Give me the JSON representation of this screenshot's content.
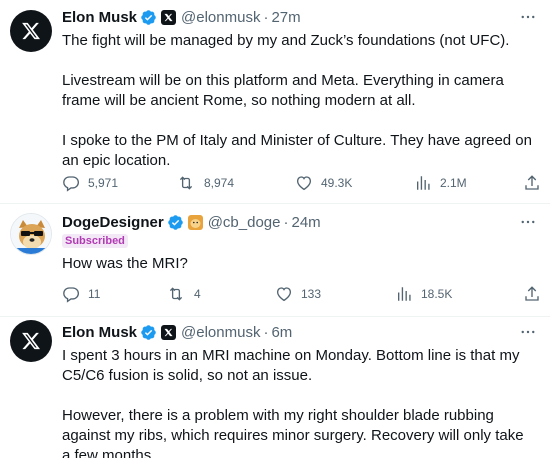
{
  "tweets": [
    {
      "name": "Elon Musk",
      "handle": "@elonmusk",
      "separator": "·",
      "time": "27m",
      "paragraphs": [
        "The fight will be managed by my and Zuck’s foundations (not UFC).",
        "Livestream will be on this platform and Meta. Everything in camera frame will be ancient Rome, so nothing modern at all.",
        "I spoke to the PM of Italy and Minister of Culture. They have agreed on an epic location."
      ],
      "replies": "5,971",
      "reposts": "8,974",
      "likes": "49.3K",
      "views": "2.1M"
    },
    {
      "name": "DogeDesigner",
      "handle": "@cb_doge",
      "separator": "·",
      "time": "24m",
      "badge": "Subscribed",
      "paragraphs": [
        "How was the MRI?"
      ],
      "replies": "11",
      "reposts": "4",
      "likes": "133",
      "views": "18.5K"
    },
    {
      "name": "Elon Musk",
      "handle": "@elonmusk",
      "separator": "·",
      "time": "6m",
      "paragraphs": [
        "I spent 3 hours in an MRI machine on Monday. Bottom line is that my C5/C6 fusion is solid, so not an issue.",
        "However, there is a problem with my right shoulder blade rubbing against my ribs, which requires minor surgery. Recovery will only take a few months."
      ]
    }
  ],
  "icons": {
    "avatar_x": "x-logo-icon",
    "verified": "verified-checkmark-icon",
    "more": "more-options-icon",
    "reply": "reply-icon",
    "repost": "repost-icon",
    "like": "heart-icon",
    "views": "views-chart-icon",
    "share": "share-icon"
  },
  "colors": {
    "text_primary": "#0f1419",
    "text_secondary": "#536471",
    "verified_blue": "#1d9bf0",
    "subscribed_purple": "#b13ab4",
    "divider": "#eff3f4"
  }
}
